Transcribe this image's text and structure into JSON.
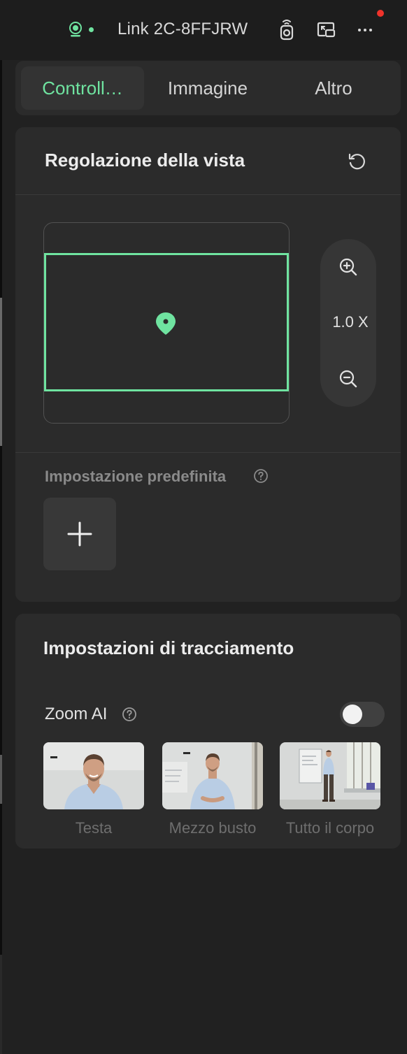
{
  "header": {
    "device_name": "Link 2C-8FFJRW",
    "status_icon": "webcam-status-icon",
    "icons": [
      "remote-control-icon",
      "picture-in-picture-icon",
      "more-icon"
    ],
    "colors": {
      "accent": "#6fe3a0",
      "notification": "#f0332b",
      "background": "#212121",
      "card": "#2b2b2b"
    }
  },
  "tabs": [
    {
      "label": "Controll…",
      "active": true
    },
    {
      "label": "Immagine",
      "active": false
    },
    {
      "label": "Altro",
      "active": false
    }
  ],
  "view_adjust": {
    "title": "Regolazione della vista",
    "zoom_level": "1.0 X",
    "preset_label": "Impostazione predefinita"
  },
  "tracking": {
    "title": "Impostazioni di tracciamento",
    "zoom_ai_label": "Zoom AI",
    "zoom_ai_enabled": false,
    "modes": [
      {
        "label": "Testa"
      },
      {
        "label": "Mezzo busto"
      },
      {
        "label": "Tutto il corpo"
      }
    ]
  }
}
